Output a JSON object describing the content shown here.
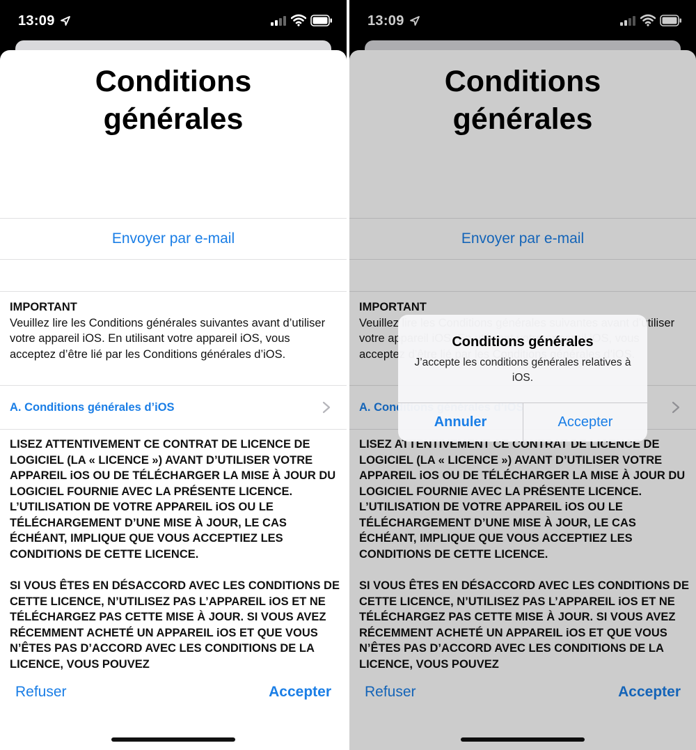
{
  "status_bar": {
    "time": "13:09"
  },
  "sheet": {
    "title_line1": "Conditions",
    "title_line2": "générales",
    "email_button": "Envoyer par e-mail",
    "important_heading": "IMPORTANT",
    "important_text": "Veuillez lire les Conditions générales suivantes avant d’utiliser votre appareil iOS. En utilisant votre appareil iOS, vous acceptez d’être lié par les Conditions générales d’iOS.",
    "section_link": "A. Conditions générales d’iOS",
    "legal_paragraph_1": "LISEZ ATTENTIVEMENT CE CONTRAT DE LICENCE DE LOGICIEL (LA « LICENCE ») AVANT D’UTILISER VOTRE APPAREIL iOS OU DE TÉLÉCHARGER LA MISE À JOUR DU LOGICIEL FOURNIE AVEC LA PRÉSENTE LICENCE. L’UTILISATION DE VOTRE APPAREIL iOS OU LE TÉLÉCHARGEMENT D’UNE MISE À JOUR, LE CAS ÉCHÉANT, IMPLIQUE QUE VOUS ACCEPTIEZ LES CONDITIONS DE CETTE LICENCE.",
    "legal_paragraph_2": "SI VOUS ÊTES EN DÉSACCORD AVEC LES CONDITIONS DE CETTE LICENCE, N’UTILISEZ PAS L’APPAREIL iOS ET NE TÉLÉCHARGEZ PAS CETTE MISE À JOUR. SI VOUS AVEZ RÉCEMMENT ACHETÉ UN APPAREIL iOS ET QUE VOUS N’ÊTES PAS D’ACCORD AVEC LES CONDITIONS DE LA LICENCE, VOUS POUVEZ"
  },
  "footer": {
    "refuse_label": "Refuser",
    "accept_label": "Accepter"
  },
  "alert": {
    "title": "Conditions générales",
    "message": "J’accepte les conditions générales relatives à iOS.",
    "cancel_label": "Annuler",
    "accept_label": "Accepter"
  },
  "icons": {
    "location": "location-arrow-icon",
    "signal": "cellular-signal-icon",
    "wifi": "wifi-icon",
    "battery": "battery-icon",
    "chevron": "chevron-right-icon"
  },
  "colors": {
    "accent": "#1a7ee6",
    "status_bar_bg": "#000000",
    "separator": "#e0e0e2"
  }
}
